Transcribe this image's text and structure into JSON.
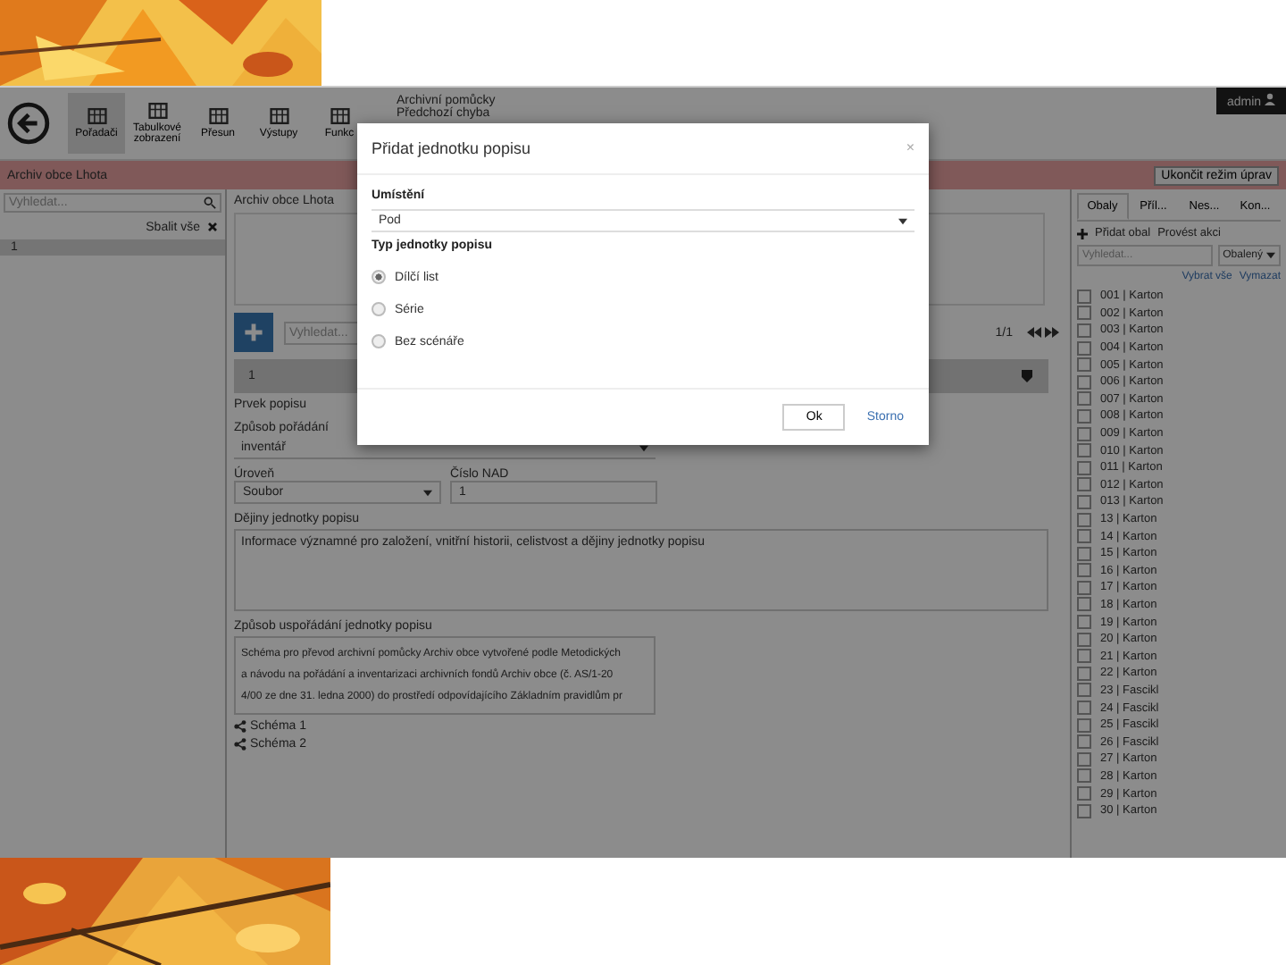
{
  "toolbar": {
    "buttons": [
      {
        "label": "Pořadači",
        "selected": true
      },
      {
        "label": "Tabulkové zobrazení",
        "selected": false
      },
      {
        "label": "Přesun",
        "selected": false
      },
      {
        "label": "Výstupy",
        "selected": false
      },
      {
        "label": "Funkc",
        "selected": false
      }
    ],
    "menu": [
      "Archivní pomůcky",
      "Předchozí chyba"
    ],
    "user": "admin"
  },
  "banner": {
    "title": "Archiv obce Lhota",
    "button": "Ukončit režim úprav"
  },
  "tree_panel": {
    "search": {
      "placeholder": "Vyhledat..."
    },
    "collapse": "Sbalit vše",
    "items": [
      {
        "label": "1",
        "selected": true
      }
    ]
  },
  "detail": {
    "breadcrumb": "Archiv obce Lhota",
    "search": {
      "placeholder": "Vyhledat..."
    },
    "pager": "1/1",
    "node": "1",
    "element": "Prvek popisu",
    "fields": [
      {
        "label": "Způsob pořádání",
        "value": "inventář"
      },
      {
        "label": "Úroveň",
        "value": "Soubor"
      },
      {
        "label": "Číslo NAD",
        "value": "1"
      }
    ],
    "history": {
      "label": "Dějiny jednotky popisu",
      "value": "Informace významné pro založení, vnitřní historii, celistvost a dějiny jednotky popisu"
    },
    "arrangement": {
      "label": "Způsob uspořádání jednotky popisu",
      "lines": [
        "Schéma pro převod archivní pomůcky Archiv obce vytvořené podle Metodických",
        "a návodu na pořádání a inventarizaci archivních fondů Archiv obce (č. AS/1-20",
        "4/00 ze dne 31. ledna 2000) do prostředí odpovídajícího Základním pravidlům pr"
      ]
    },
    "schemes": [
      "Schéma 1",
      "Schéma 2"
    ]
  },
  "side_panel": {
    "tabs": [
      {
        "label": "Obaly",
        "selected": true
      },
      {
        "label": "Příl...",
        "selected": false
      },
      {
        "label": "Nes...",
        "selected": false
      },
      {
        "label": "Kon...",
        "selected": false
      }
    ],
    "actions": [
      "Přidat obal",
      "Provést akci"
    ],
    "search": {
      "placeholder": "Vyhledat..."
    },
    "filter": "Obalený",
    "select_all": "Vybrat vše",
    "clear": "Vymazat",
    "items": [
      {
        "label": "001 | Karton",
        "checked": false
      },
      {
        "label": "002 | Karton",
        "checked": false
      },
      {
        "label": "003 | Karton",
        "checked": false
      },
      {
        "label": "004 | Karton",
        "checked": false
      },
      {
        "label": "005 | Karton",
        "checked": false
      },
      {
        "label": "006 | Karton",
        "checked": false
      },
      {
        "label": "007 | Karton",
        "checked": false
      },
      {
        "label": "008 | Karton",
        "checked": false
      },
      {
        "label": "009 | Karton",
        "checked": false
      },
      {
        "label": "010 | Karton",
        "checked": false
      },
      {
        "label": "011 | Karton",
        "checked": false
      },
      {
        "label": "012 | Karton",
        "checked": false
      },
      {
        "label": "013 | Karton",
        "checked": false
      },
      {
        "label": "13 | Karton",
        "checked": false
      },
      {
        "label": "14 | Karton",
        "checked": false
      },
      {
        "label": "15 | Karton",
        "checked": false
      },
      {
        "label": "16 | Karton",
        "checked": false
      },
      {
        "label": "17 | Karton",
        "checked": false
      },
      {
        "label": "18 | Karton",
        "checked": false
      },
      {
        "label": "19 | Karton",
        "checked": false
      },
      {
        "label": "20 | Karton",
        "checked": false
      },
      {
        "label": "21 | Karton",
        "checked": false
      },
      {
        "label": "22 | Karton",
        "checked": false
      },
      {
        "label": "23 | Fascikl",
        "checked": false
      },
      {
        "label": "24 | Fascikl",
        "checked": false
      },
      {
        "label": "25 | Fascikl",
        "checked": false
      },
      {
        "label": "26 | Fascikl",
        "checked": false
      },
      {
        "label": "27 | Karton",
        "checked": false
      },
      {
        "label": "28 | Karton",
        "checked": false
      },
      {
        "label": "29 | Karton",
        "checked": false
      },
      {
        "label": "30 | Karton",
        "checked": false
      }
    ]
  },
  "dialog": {
    "title": "Přidat jednotku popisu",
    "close": "×",
    "location": {
      "label": "Umístění",
      "value": "Pod"
    },
    "type_label": "Typ jednotky popisu",
    "options": [
      {
        "label": "Dílčí list",
        "selected": true
      },
      {
        "label": "Série",
        "selected": false
      },
      {
        "label": "Bez scénáře",
        "selected": false
      }
    ],
    "buttons": [
      "Ok",
      "Storno"
    ]
  }
}
